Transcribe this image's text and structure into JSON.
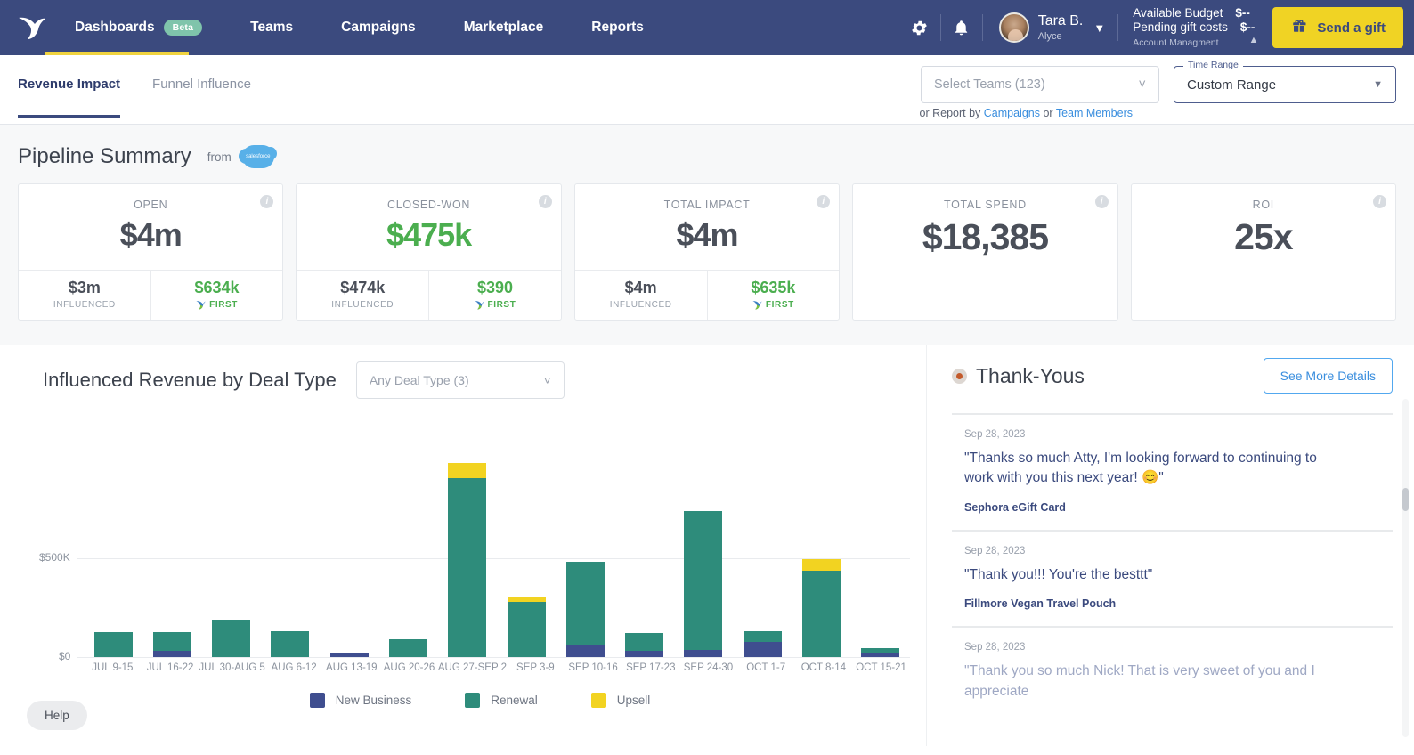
{
  "topnav": {
    "logo_icon": "alyce-bird-logo",
    "items": [
      {
        "label": "Dashboards",
        "badge": "Beta",
        "active": true
      },
      {
        "label": "Teams",
        "active": false
      },
      {
        "label": "Campaigns",
        "active": false
      },
      {
        "label": "Marketplace",
        "active": false
      },
      {
        "label": "Reports",
        "active": false
      }
    ],
    "gear_icon": "gear-icon",
    "bell_icon": "bell-icon",
    "user": {
      "name": "Tara B.",
      "org": "Alyce"
    },
    "budget": {
      "available_label": "Available Budget",
      "available_value": "$--",
      "pending_label": "Pending gift costs",
      "pending_value": "$--",
      "account_label": "Account Managment"
    },
    "send_gift_label": "Send a gift",
    "accent_yellow": "#f0d324",
    "nav_blue": "#3b4a7e"
  },
  "subheader": {
    "tabs": [
      {
        "label": "Revenue Impact",
        "active": true
      },
      {
        "label": "Funnel Influence",
        "active": false
      }
    ],
    "select_teams_placeholder": "Select Teams (123)",
    "report_by_prefix": "or Report by",
    "report_by_link1": "Campaigns",
    "report_by_mid": "or",
    "report_by_link2": "Team Members",
    "time_range_label": "Time Range",
    "time_range_value": "Custom Range"
  },
  "summary": {
    "title": "Pipeline Summary",
    "from_label": "from",
    "source": "salesforce",
    "cards": [
      {
        "label": "OPEN",
        "value": "$4m",
        "value_color": "dark",
        "foot": [
          {
            "value": "$3m",
            "sub": "INFLUENCED",
            "green": false,
            "first": false
          },
          {
            "value": "$634k",
            "sub": "FIRST",
            "green": true,
            "first": true
          }
        ]
      },
      {
        "label": "CLOSED-WON",
        "value": "$475k",
        "value_color": "green",
        "foot": [
          {
            "value": "$474k",
            "sub": "INFLUENCED",
            "green": false,
            "first": false
          },
          {
            "value": "$390",
            "sub": "FIRST",
            "green": true,
            "first": true
          }
        ]
      },
      {
        "label": "TOTAL IMPACT",
        "value": "$4m",
        "value_color": "dark",
        "foot": [
          {
            "value": "$4m",
            "sub": "INFLUENCED",
            "green": false,
            "first": false
          },
          {
            "value": "$635k",
            "sub": "FIRST",
            "green": true,
            "first": true
          }
        ]
      },
      {
        "label": "TOTAL SPEND",
        "value": "$18,385",
        "value_color": "dark",
        "big": true,
        "foot": []
      },
      {
        "label": "ROI",
        "value": "25x",
        "value_color": "dark",
        "foot": []
      }
    ]
  },
  "chart_panel": {
    "title": "Influenced Revenue by Deal Type",
    "deal_type_placeholder": "Any Deal Type (3)",
    "help_label": "Help"
  },
  "chart_data": {
    "type": "bar",
    "stacked": true,
    "title": "Influenced Revenue by Deal Type",
    "xlabel": "",
    "ylabel": "",
    "ylim": [
      0,
      1000000
    ],
    "yticks": [
      0,
      500000
    ],
    "ytick_labels": [
      "$0",
      "$500K"
    ],
    "grid": true,
    "legend_position": "bottom",
    "categories": [
      "JUL 9-15",
      "JUL 16-22",
      "JUL 30-AUG 5",
      "AUG 6-12",
      "AUG 13-19",
      "AUG 20-26",
      "AUG 27-SEP 2",
      "SEP 3-9",
      "SEP 10-16",
      "SEP 17-23",
      "SEP 24-30",
      "OCT 1-7",
      "OCT 8-14",
      "OCT 15-21"
    ],
    "series": [
      {
        "name": "New Business",
        "color": "#3f4e8f",
        "values": [
          0,
          30000,
          0,
          0,
          22000,
          0,
          0,
          0,
          60000,
          30000,
          38000,
          75000,
          0,
          22000
        ]
      },
      {
        "name": "Renewal",
        "color": "#2e8c7b",
        "values": [
          125000,
          95000,
          190000,
          130000,
          0,
          90000,
          905000,
          280000,
          420000,
          90000,
          700000,
          55000,
          435000,
          22000
        ]
      },
      {
        "name": "Upsell",
        "color": "#f2d321",
        "values": [
          0,
          0,
          0,
          0,
          0,
          0,
          78000,
          25000,
          0,
          0,
          0,
          0,
          60000,
          0
        ]
      }
    ]
  },
  "thank_yous": {
    "title": "Thank-Yous",
    "see_more_label": "See More Details",
    "items": [
      {
        "date": "Sep 28, 2023",
        "text": "\"Thanks so much Atty, I'm looking forward to continuing to work with you this next year! 😊\"",
        "gift": "Sephora eGift Card",
        "faded": false
      },
      {
        "date": "Sep 28, 2023",
        "text": "\"Thank you!!! You're the besttt\"",
        "gift": "Fillmore Vegan Travel Pouch",
        "faded": false
      },
      {
        "date": "Sep 28, 2023",
        "text": "\"Thank you so much Nick! That is very sweet of you and I appreciate",
        "gift": "",
        "faded": true
      }
    ]
  }
}
